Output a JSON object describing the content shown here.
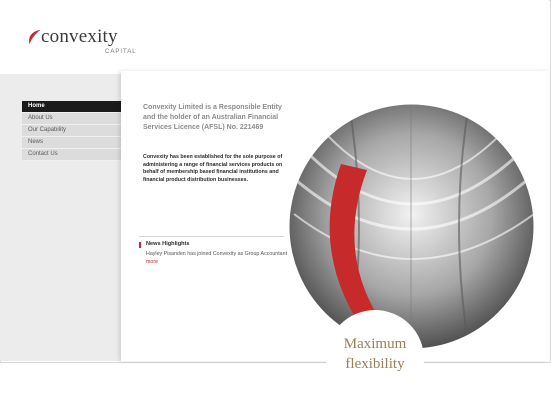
{
  "brand": {
    "name": "convexity",
    "subtitle": "CAPITAL",
    "accent_color": "#c62a2a",
    "logo_icon": "swoosh-logo-icon"
  },
  "nav": {
    "items": [
      {
        "label": "Home",
        "active": true
      },
      {
        "label": "About Us",
        "active": false
      },
      {
        "label": "Our Capability",
        "active": false
      },
      {
        "label": "News",
        "active": false
      },
      {
        "label": "Contact Us",
        "active": false
      }
    ]
  },
  "content": {
    "intro": "Convexity Limited is a Responsible Entity and the holder of an Australian Financial Services Licence (AFSL) No. 221469",
    "body": "Convexity has been established for the sole purpose of administering a range of financial services products on behalf of membership based financial institutions and financial product distribution businesses."
  },
  "news": {
    "title": "News Highlights",
    "item": "Hayley Pisanden has joined Convexity as Group Accountant",
    "more": "more"
  },
  "hero": {
    "line1": "Maximum",
    "line2": "flexibility",
    "tagline_color": "#9a7f55"
  }
}
